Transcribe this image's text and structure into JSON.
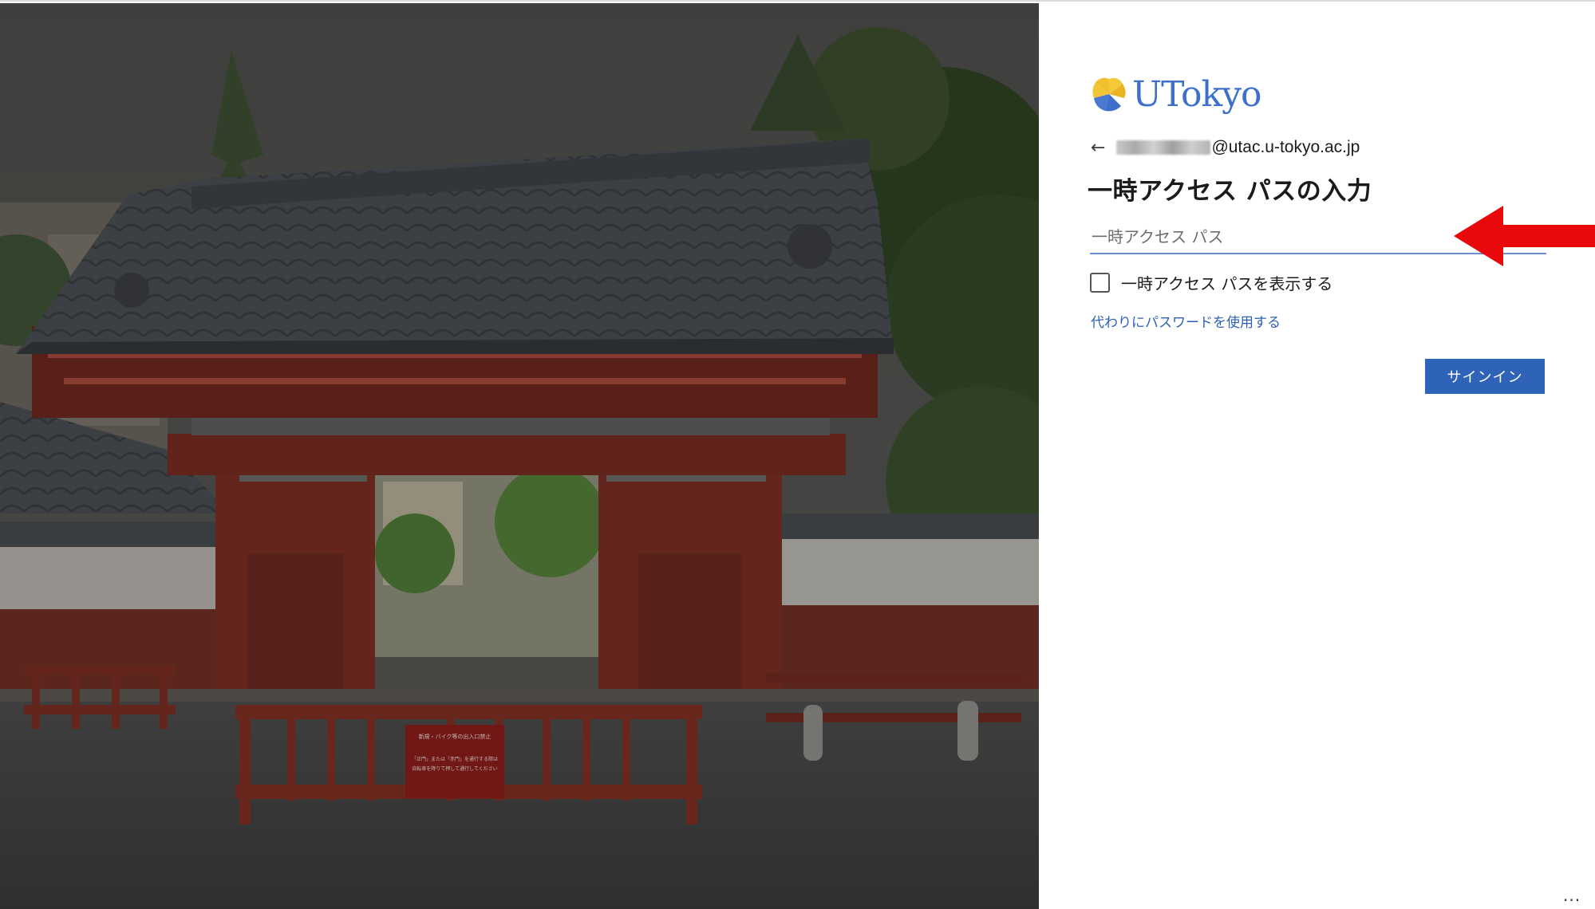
{
  "brand": {
    "name": "UTokyo",
    "color": "#3d6fcb"
  },
  "identity": {
    "back_icon": "←",
    "email_suffix": "@utac.u-tokyo.ac.jp"
  },
  "form": {
    "title": "一時アクセス パスの入力",
    "password_placeholder": "一時アクセス パス",
    "password_value": "",
    "show_password_label": "一時アクセス パスを表示する",
    "show_password_checked": false,
    "alt_link": "代わりにパスワードを使用する",
    "submit_label": "サインイン"
  },
  "footer": {
    "more_label": "..."
  },
  "sign_text": [
    "新規・バイク等の出入口禁止",
    "「正門」または「赤門」を通行する際は",
    "自転車を降りて押して通行してください"
  ],
  "colors": {
    "accent": "#2f63b8",
    "link": "#2f62b5",
    "annotation": "#e8090d"
  },
  "icons": {
    "back": "back-arrow-icon",
    "annotation": "red-arrow-icon",
    "logo": "ginkgo-leaf-logo-icon"
  }
}
